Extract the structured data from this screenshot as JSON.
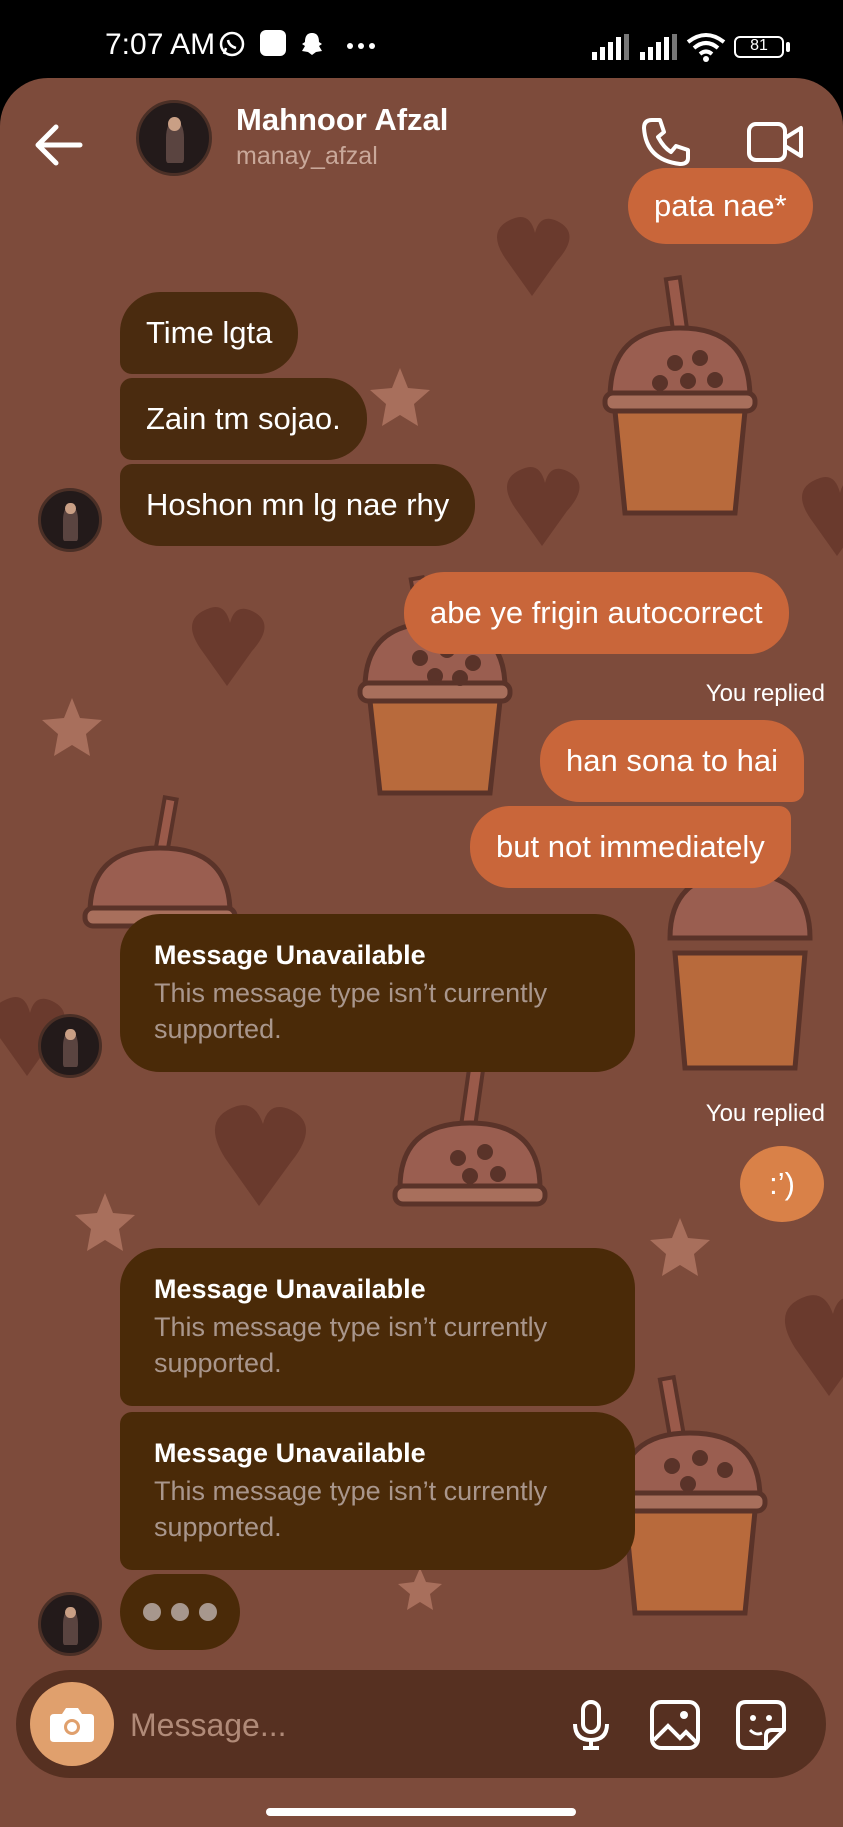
{
  "status_bar": {
    "time": "7:07 AM",
    "battery": "81",
    "icons": [
      "whatsapp-icon",
      "app-icon",
      "snapchat-icon",
      "more-dots-icon",
      "signal-icon",
      "signal-icon",
      "wifi-icon",
      "battery-icon"
    ]
  },
  "header": {
    "contact_name": "Mahnoor Afzal",
    "username": "manay_afzal",
    "icons": [
      "back-arrow-icon",
      "phone-icon",
      "video-camera-icon"
    ]
  },
  "messages": [
    {
      "side": "sent",
      "text": "pata nae*"
    },
    {
      "side": "received",
      "text": "Time lgta"
    },
    {
      "side": "received",
      "text": "Zain tm sojao."
    },
    {
      "side": "received",
      "text": "Hoshon mn lg nae rhy"
    },
    {
      "side": "sent",
      "text": "abe ye frigin autocorrect"
    },
    {
      "side": "sent",
      "reply_label": "You replied",
      "text": "han sona to hai"
    },
    {
      "side": "sent",
      "text": "but not immediately"
    },
    {
      "side": "received",
      "title": "Message Unavailable",
      "text": "This message type isn’t currently supported."
    },
    {
      "side": "sent",
      "reply_label": "You replied",
      "text": ":’)"
    },
    {
      "side": "received",
      "title": "Message Unavailable",
      "text": "This message type isn’t currently supported."
    },
    {
      "side": "received",
      "title": "Message Unavailable",
      "text": "This message type isn’t currently supported."
    }
  ],
  "composer": {
    "placeholder": "Message...",
    "icons": [
      "camera-icon",
      "microphone-icon",
      "gallery-icon",
      "sticker-icon"
    ]
  },
  "colors": {
    "background": "#7d4b3b",
    "sent_bubble": "#c9663a",
    "received_bubble": "#4a2b0f",
    "composer": "#563021",
    "camera_button": "#e0a06d"
  }
}
